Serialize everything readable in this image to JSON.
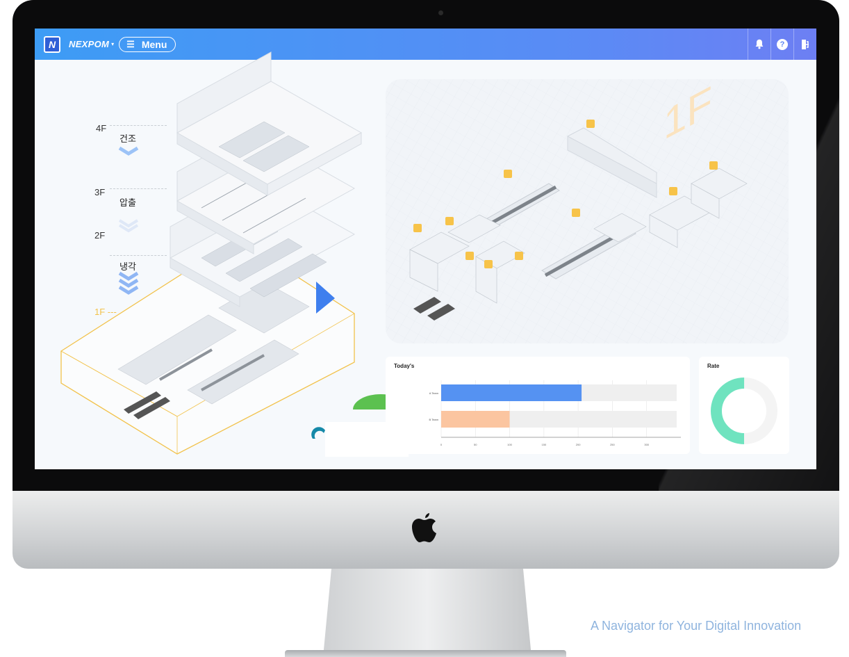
{
  "header": {
    "logo_letter": "N",
    "brand": "NEXPOM",
    "brand_caret": "▾",
    "menu_icon": "☰",
    "menu_label": "Menu",
    "icons": [
      "bell-icon",
      "help-icon",
      "logout-icon"
    ],
    "help_glyph": "?"
  },
  "floors": [
    {
      "level": "4F",
      "name": "건조"
    },
    {
      "level": "3F",
      "name": "압출"
    },
    {
      "level": "2F",
      "name": "냉각"
    },
    {
      "level": "1F ---",
      "name": ""
    }
  ],
  "panels": {
    "today_title": "Today's",
    "rate_title": "Rate",
    "watermark": "1F"
  },
  "chart_data": [
    {
      "type": "bar",
      "orientation": "horizontal",
      "title": "Today's",
      "categories": [
        "A Team",
        "B Team"
      ],
      "values": [
        205,
        100
      ],
      "colors": [
        "#5592f2",
        "#fbc5a0"
      ],
      "xlim": [
        0,
        350
      ],
      "xticks": [
        "0",
        "50",
        "100",
        "150",
        "200",
        "250",
        "300"
      ],
      "grid": true
    },
    {
      "type": "pie",
      "style": "donut",
      "title": "Rate",
      "values": [
        50,
        50
      ],
      "colors": [
        "#6fe3bf",
        "#f4f4f4"
      ]
    }
  ],
  "monitor": {
    "tagline": "A Navigator for Your Digital Innovation"
  },
  "colors": {
    "topbar": "#4a94f5",
    "accent_yellow": "#f7c349",
    "floor_outline": "#f2c24b",
    "pointer": "#3f7fee"
  }
}
